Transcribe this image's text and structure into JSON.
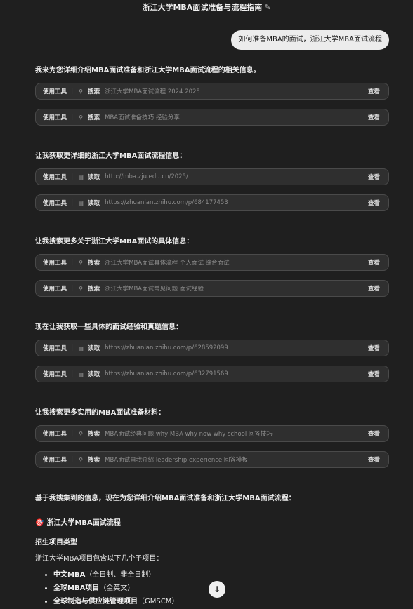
{
  "header": {
    "title": "浙江大学MBA面试准备与流程指南",
    "edit_icon": "✎"
  },
  "user_message": "如何准备MBA的面试，浙江大学MBA面试流程",
  "tool_common": {
    "label": "使用工具",
    "separator": "|",
    "view": "查看"
  },
  "groups": [
    {
      "intro": "我来为您详细介绍MBA面试准备和浙江大学MBA面试流程的相关信息。",
      "tools": [
        {
          "icon": "search-icon",
          "glyph": "⚲",
          "action": "搜索",
          "query": "浙江大学MBA面试流程 2024 2025"
        },
        {
          "icon": "search-icon",
          "glyph": "⚲",
          "action": "搜索",
          "query": "MBA面试准备技巧 经验分享"
        }
      ]
    },
    {
      "intro": "让我获取更详细的浙江大学MBA面试流程信息：",
      "tools": [
        {
          "icon": "document-icon",
          "glyph": "▤",
          "action": "读取",
          "query": "http://mba.zju.edu.cn/2025/"
        },
        {
          "icon": "document-icon",
          "glyph": "▤",
          "action": "读取",
          "query": "https://zhuanlan.zhihu.com/p/684177453"
        }
      ]
    },
    {
      "intro": "让我搜索更多关于浙江大学MBA面试的具体信息：",
      "tools": [
        {
          "icon": "search-icon",
          "glyph": "⚲",
          "action": "搜索",
          "query": "浙江大学MBA面试具体流程 个人面试 综合面试"
        },
        {
          "icon": "search-icon",
          "glyph": "⚲",
          "action": "搜索",
          "query": "浙江大学MBA面试常见问题 面试经验"
        }
      ]
    },
    {
      "intro": "现在让我获取一些具体的面试经验和真题信息：",
      "tools": [
        {
          "icon": "document-icon",
          "glyph": "▤",
          "action": "读取",
          "query": "https://zhuanlan.zhihu.com/p/628592099"
        },
        {
          "icon": "document-icon",
          "glyph": "▤",
          "action": "读取",
          "query": "https://zhuanlan.zhihu.com/p/632791569"
        }
      ]
    },
    {
      "intro": "让我搜索更多实用的MBA面试准备材料：",
      "tools": [
        {
          "icon": "search-icon",
          "glyph": "⚲",
          "action": "搜索",
          "query": "MBA面试经典问题 why MBA why now why school 回答技巧"
        },
        {
          "icon": "search-icon",
          "glyph": "⚲",
          "action": "搜索",
          "query": "MBA面试自我介绍 leadership experience 回答模板"
        }
      ]
    }
  ],
  "summary": {
    "intro": "基于我搜集到的信息，现在为您详细介绍MBA面试准备和浙江大学MBA面试流程：",
    "section_icon": "🎯",
    "section_title": "浙江大学MBA面试流程",
    "subheading": "招生项目类型",
    "paragraph": "浙江大学MBA项目包含以下几个子项目：",
    "bullets": [
      {
        "bold": "中文MBA",
        "rest": "（全日制、非全日制）"
      },
      {
        "bold": "全球MBA项目",
        "rest": "（全英文）"
      },
      {
        "bold": "全球制造与供应链管理项目",
        "rest": "（GMSCM）"
      }
    ]
  },
  "scroll_button": "↓"
}
